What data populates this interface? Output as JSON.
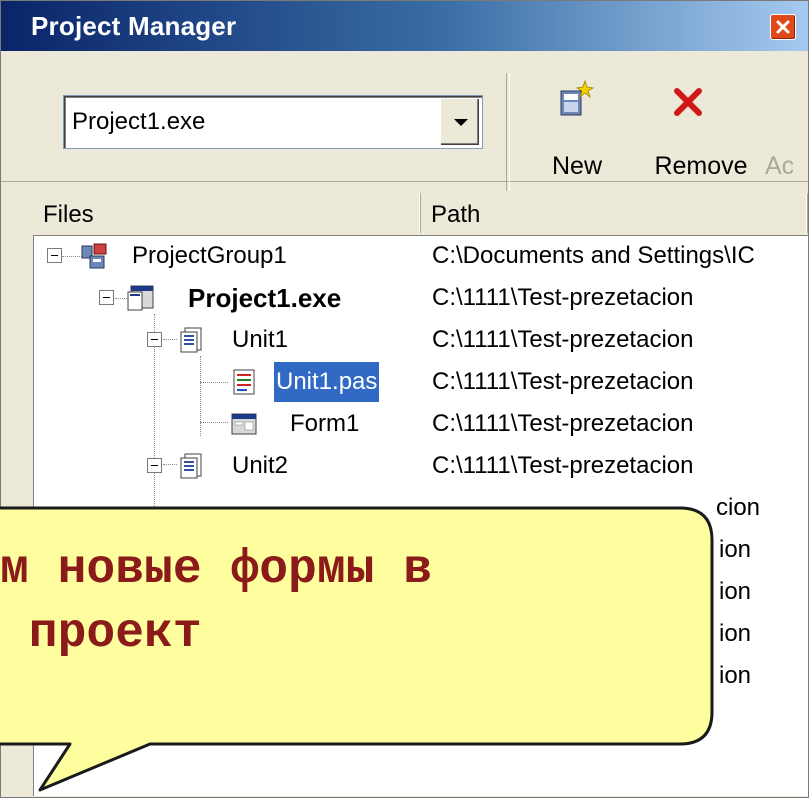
{
  "window": {
    "title": "Project Manager",
    "title_gradient_start": "#0a246a",
    "title_gradient_end": "#a6caf0"
  },
  "toolbar": {
    "target_value": "Project1.exe",
    "new_label": "New",
    "remove_label": "Remove",
    "activate_label": "Ac"
  },
  "columns": {
    "files": "Files",
    "path": "Path"
  },
  "tree": [
    {
      "name": "ProjectGroup1",
      "path": "C:\\Documents and Settings\\IC",
      "icon": "project-group-icon"
    },
    {
      "name": "Project1.exe",
      "path": "C:\\1111\\Test-prezetacion",
      "icon": "project-icon"
    },
    {
      "name": "Unit1",
      "path": "C:\\1111\\Test-prezetacion",
      "icon": "unit-icon"
    },
    {
      "name": "Unit1.pas",
      "path": "C:\\1111\\Test-prezetacion",
      "icon": "pas-file-icon"
    },
    {
      "name": "Form1",
      "path": "C:\\1111\\Test-prezetacion",
      "icon": "form-icon"
    },
    {
      "name": "Unit2",
      "path": "C:\\1111\\Test-prezetacion",
      "icon": "unit-icon"
    },
    {
      "path_tail": "cion"
    },
    {
      "path_tail": "ion"
    },
    {
      "path_tail": "ion"
    },
    {
      "path_tail": "ion"
    },
    {
      "path_tail": "ion"
    }
  ],
  "callout": {
    "line1": "м новые формы в",
    "line2": " проект",
    "text_color": "#8b1a1a",
    "fill_color": "#fefe9e"
  },
  "colors": {
    "selection": "#316ac5",
    "face": "#ece9d8"
  }
}
